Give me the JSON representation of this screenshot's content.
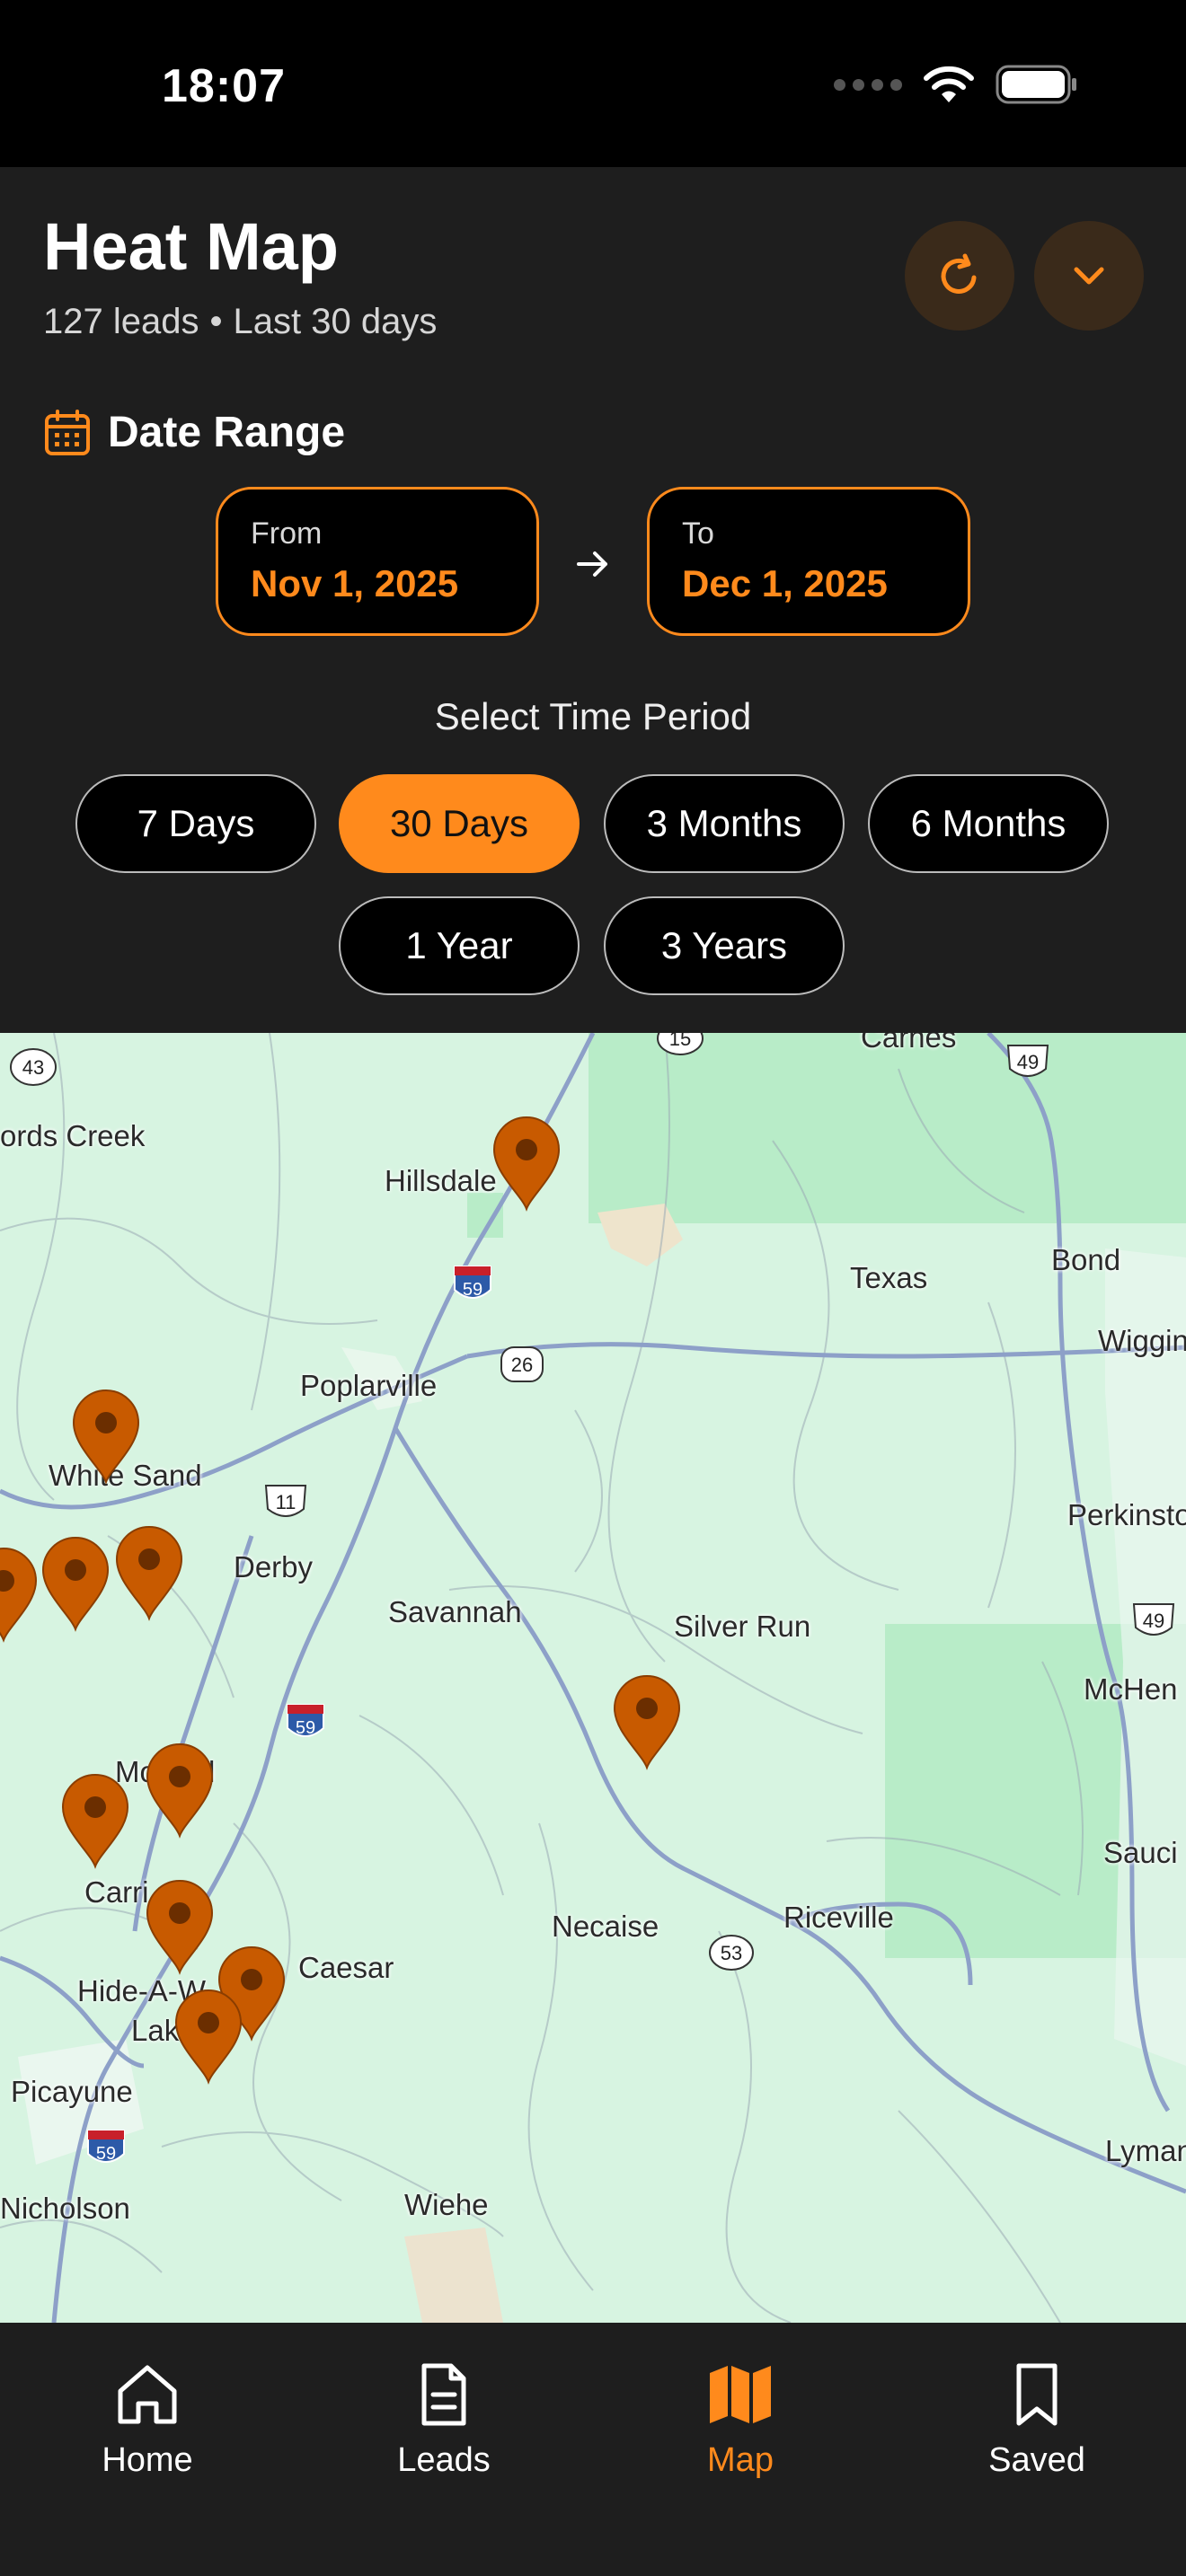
{
  "status_bar": {
    "time": "18:07"
  },
  "header": {
    "title": "Heat Map",
    "lead_count": "127 leads",
    "separator": "•",
    "period": "Last 30 days"
  },
  "date_range": {
    "label": "Date Range",
    "from_label": "From",
    "from_value": "Nov 1, 2025",
    "to_label": "To",
    "to_value": "Dec 1, 2025"
  },
  "time_period": {
    "label": "Select Time Period",
    "options": [
      "7 Days",
      "30 Days",
      "3 Months",
      "6 Months",
      "1 Year",
      "3 Years"
    ],
    "selected": "30 Days"
  },
  "map": {
    "places": [
      "ords Creek",
      "Hillsdale",
      "Texas",
      "Bond",
      "Wiggin",
      "Poplarville",
      "White Sand",
      "Derby",
      "Perkinsto",
      "Savannah",
      "Silver Run",
      "McHen",
      "Mo",
      "l",
      "Carri",
      "Sauci",
      "Necaise",
      "Riceville",
      "Caesar",
      "Hide-A-W",
      "Lak",
      "Picayune",
      "Lyman",
      "Nicholson",
      "Wiehe",
      "Carnes"
    ],
    "road_shields": [
      "43",
      "15",
      "49",
      "59",
      "26",
      "11",
      "49",
      "59",
      "53",
      "59"
    ],
    "pin_count": 11
  },
  "bottom_nav": {
    "items": [
      {
        "label": "Home",
        "icon": "home-icon"
      },
      {
        "label": "Leads",
        "icon": "document-icon"
      },
      {
        "label": "Map",
        "icon": "map-icon"
      },
      {
        "label": "Saved",
        "icon": "bookmark-icon"
      }
    ],
    "active": "Map"
  },
  "colors": {
    "accent": "#ff8a1c",
    "pin": "#c85a00",
    "map_bg": "#d7f4e1",
    "panel": "#1e1e1e"
  }
}
